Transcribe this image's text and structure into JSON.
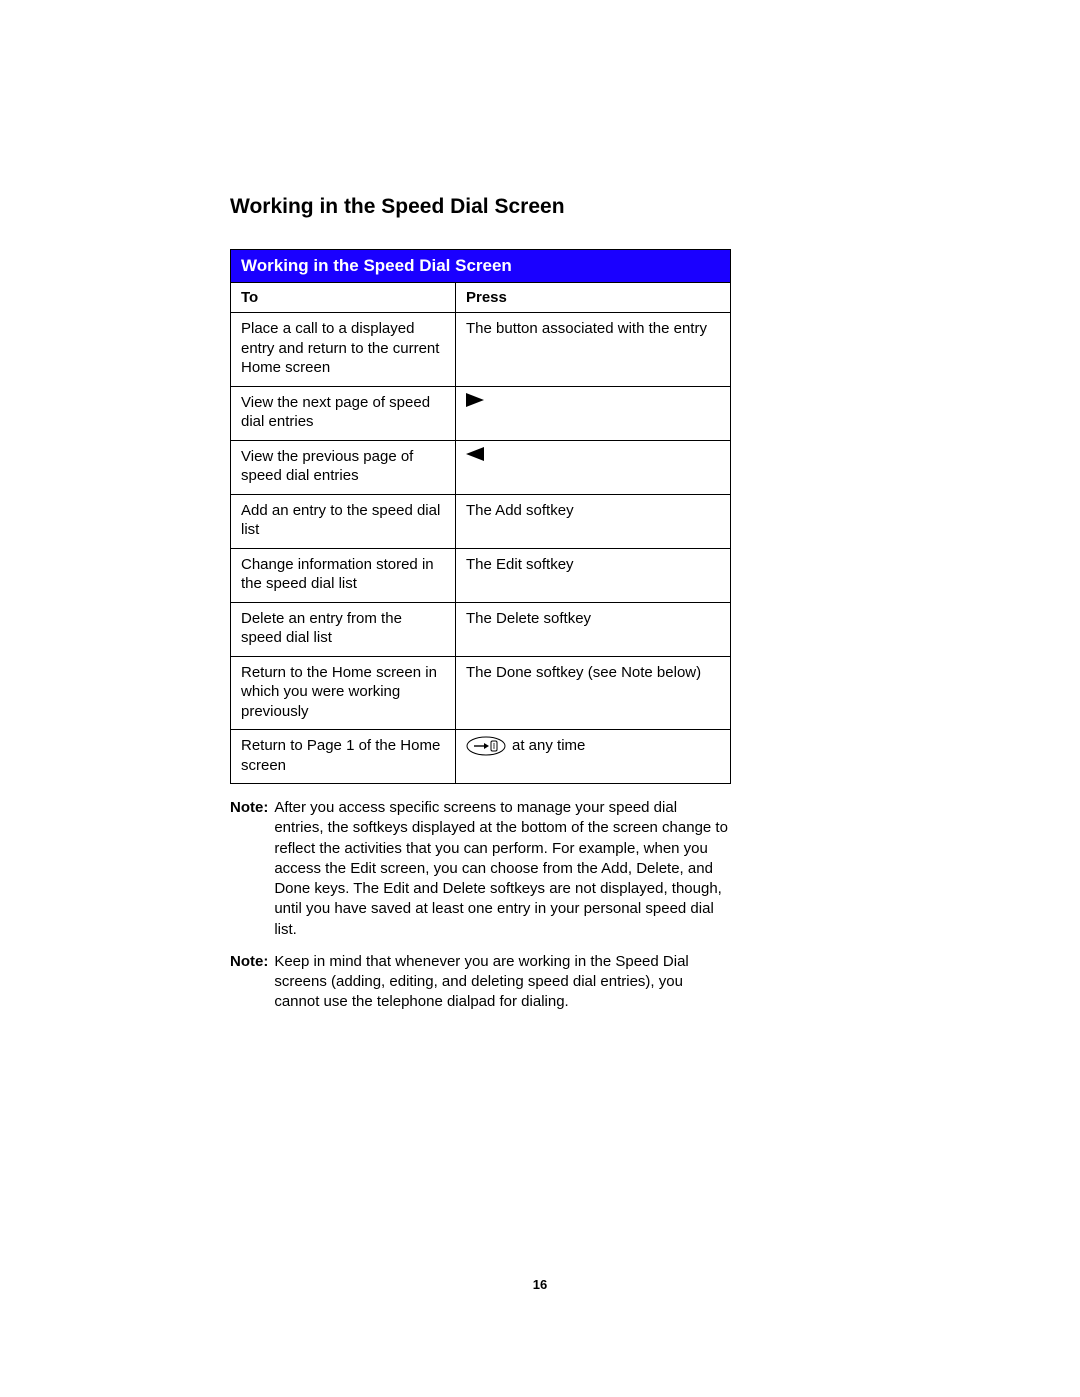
{
  "heading": "Working in the Speed Dial Screen",
  "table": {
    "title": "Working in the Speed Dial Screen",
    "headers": {
      "to": "To",
      "press": "Press"
    },
    "rows": [
      {
        "to": "Place a call to a displayed entry and return to the current Home screen",
        "press": "The button associated with the entry",
        "icon": null,
        "suffix": null
      },
      {
        "to": "View the next page of speed dial entries",
        "press": "",
        "icon": "triangle-right",
        "suffix": null
      },
      {
        "to": "View the previous page of speed dial entries",
        "press": "",
        "icon": "triangle-left",
        "suffix": null
      },
      {
        "to": "Add an entry to the speed dial list",
        "press": "The Add softkey",
        "icon": null,
        "suffix": null
      },
      {
        "to": "Change information stored in the speed dial list",
        "press": "The Edit softkey",
        "icon": null,
        "suffix": null
      },
      {
        "to": "Delete an entry from the speed dial list",
        "press": "The Delete softkey",
        "icon": null,
        "suffix": null
      },
      {
        "to": "Return to the Home screen in which you were working previously",
        "press": "The Done softkey (see Note below)",
        "icon": null,
        "suffix": null
      },
      {
        "to": "Return to Page 1 of the Home screen",
        "press": "",
        "icon": "phone-exit",
        "suffix": "at any time"
      }
    ]
  },
  "notes": [
    {
      "label": "Note:",
      "body": "After you access specific screens to manage your speed dial entries, the softkeys displayed at the bottom of the screen change to reflect the activities that you can perform. For example, when you access the Edit screen, you can choose from the Add, Delete, and Done keys. The Edit and Delete softkeys are not displayed, though, until you have saved at least one entry in your personal speed dial list."
    },
    {
      "label": "Note:",
      "body": "Keep in mind that whenever you are working in the Speed Dial screens (adding, editing, and deleting speed dial entries), you cannot use the telephone dialpad for dialing."
    }
  ],
  "pageNumber": "16"
}
